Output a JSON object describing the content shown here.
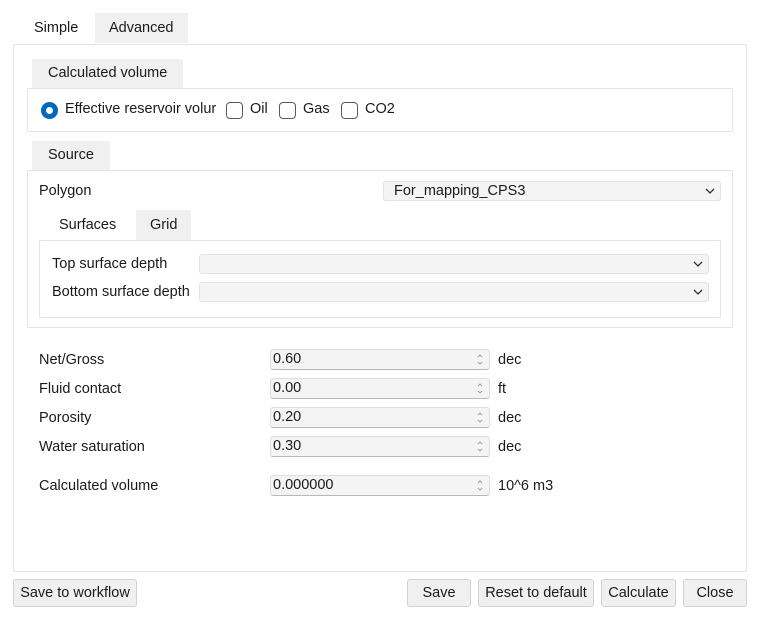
{
  "tabs": {
    "simple": "Simple",
    "advanced": "Advanced"
  },
  "calc_volume_group": {
    "tab": "Calculated volume",
    "options": {
      "effective": "Effective reservoir volur",
      "oil": "Oil",
      "gas": "Gas",
      "co2": "CO2"
    },
    "selected": "effective"
  },
  "source_group": {
    "tab": "Source",
    "polygon_label": "Polygon",
    "polygon_value": "For_mapping_CPS3",
    "sub_tabs": {
      "surfaces": "Surfaces",
      "grid": "Grid"
    },
    "top_surface_label": "Top surface depth",
    "top_surface_value": "",
    "bottom_surface_label": "Bottom surface depth",
    "bottom_surface_value": ""
  },
  "params": [
    {
      "label": "Net/Gross",
      "value": "0.60",
      "unit": "dec"
    },
    {
      "label": "Fluid contact",
      "value": "0.00",
      "unit": "ft"
    },
    {
      "label": "Porosity",
      "value": "0.20",
      "unit": "dec"
    },
    {
      "label": "Water saturation",
      "value": "0.30",
      "unit": "dec"
    }
  ],
  "result": {
    "label": "Calculated volume",
    "value": "0.000000",
    "unit": "10^6 m3"
  },
  "buttons": {
    "save_to_workflow": "Save to workflow",
    "save": "Save",
    "reset": "Reset to default",
    "calculate": "Calculate",
    "close": "Close"
  }
}
